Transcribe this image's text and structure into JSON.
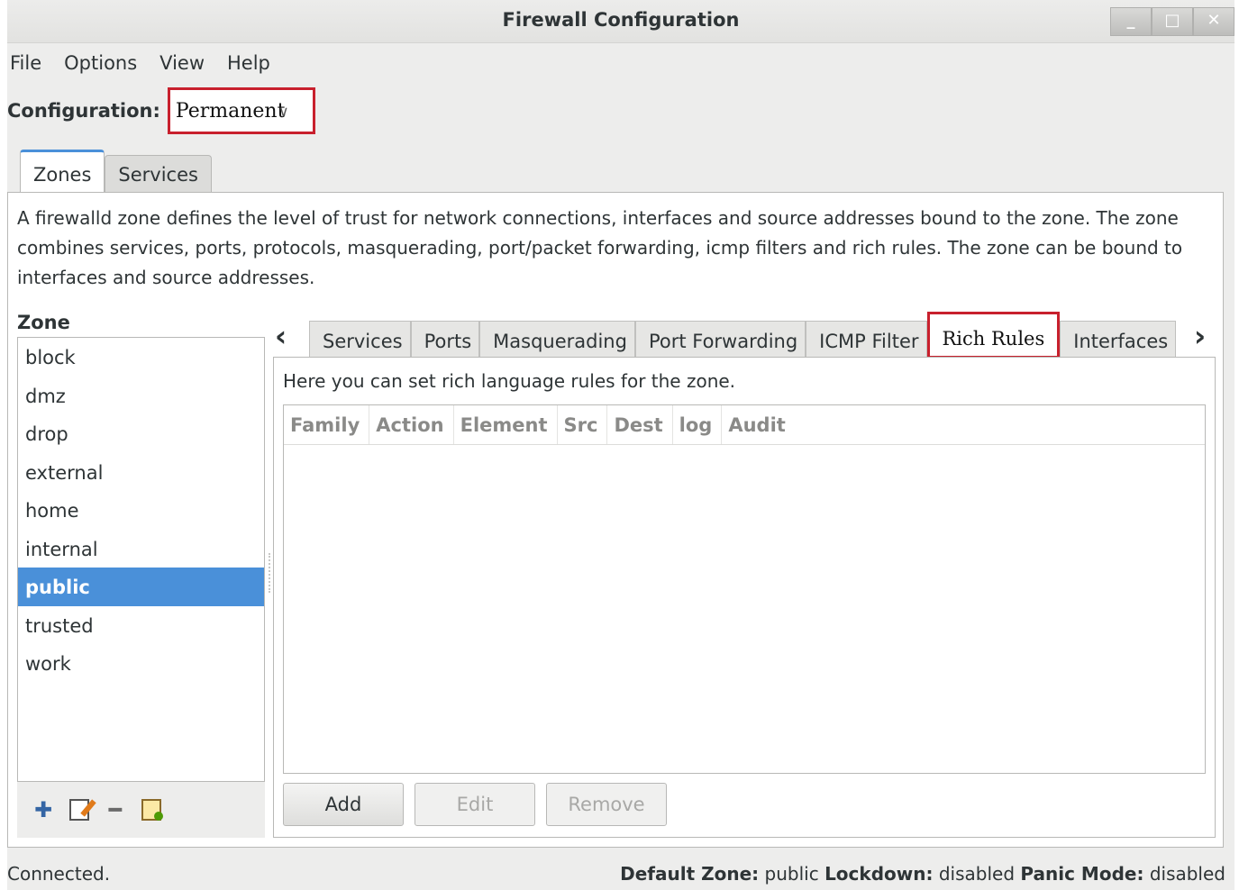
{
  "window": {
    "title": "Firewall Configuration",
    "controls": {
      "minimize": "_",
      "maximize": "□",
      "close": "✕"
    }
  },
  "menubar": {
    "items": [
      "File",
      "Options",
      "View",
      "Help"
    ]
  },
  "configuration": {
    "label": "Configuration:",
    "value": "Permanent"
  },
  "top_tabs": [
    {
      "label": "Zones",
      "active": true
    },
    {
      "label": "Services",
      "active": false
    }
  ],
  "description": "A firewalld zone defines the level of trust for network connections, interfaces and source addresses bound to the zone. The zone combines services, ports, protocols, masquerading, port/packet forwarding, icmp filters and rich rules. The zone can be bound to interfaces and source addresses.",
  "zones": {
    "label": "Zone",
    "items": [
      "block",
      "dmz",
      "drop",
      "external",
      "home",
      "internal",
      "public",
      "trusted",
      "work"
    ],
    "selected": "public"
  },
  "zone_tools": [
    "add-icon",
    "edit-icon",
    "remove-icon",
    "load-defaults-icon"
  ],
  "inner_tabs": {
    "items": [
      "Services",
      "Ports",
      "Masquerading",
      "Port Forwarding",
      "ICMP Filter",
      "Rich Rules",
      "Interfaces"
    ],
    "active": "Rich Rules"
  },
  "rich_rules": {
    "description": "Here you can set rich language rules for the zone.",
    "columns": [
      "Family",
      "Action",
      "Element",
      "Src",
      "Dest",
      "log",
      "Audit"
    ],
    "buttons": {
      "add": "Add",
      "edit": "Edit",
      "remove": "Remove"
    }
  },
  "status": {
    "connection": "Connected.",
    "default_zone_label": "Default Zone:",
    "default_zone_value": "public",
    "lockdown_label": "Lockdown:",
    "lockdown_value": "disabled",
    "panic_label": "Panic Mode:",
    "panic_value": "disabled"
  },
  "colors": {
    "accent": "#4a90d9",
    "highlight_box": "#c8202d"
  }
}
